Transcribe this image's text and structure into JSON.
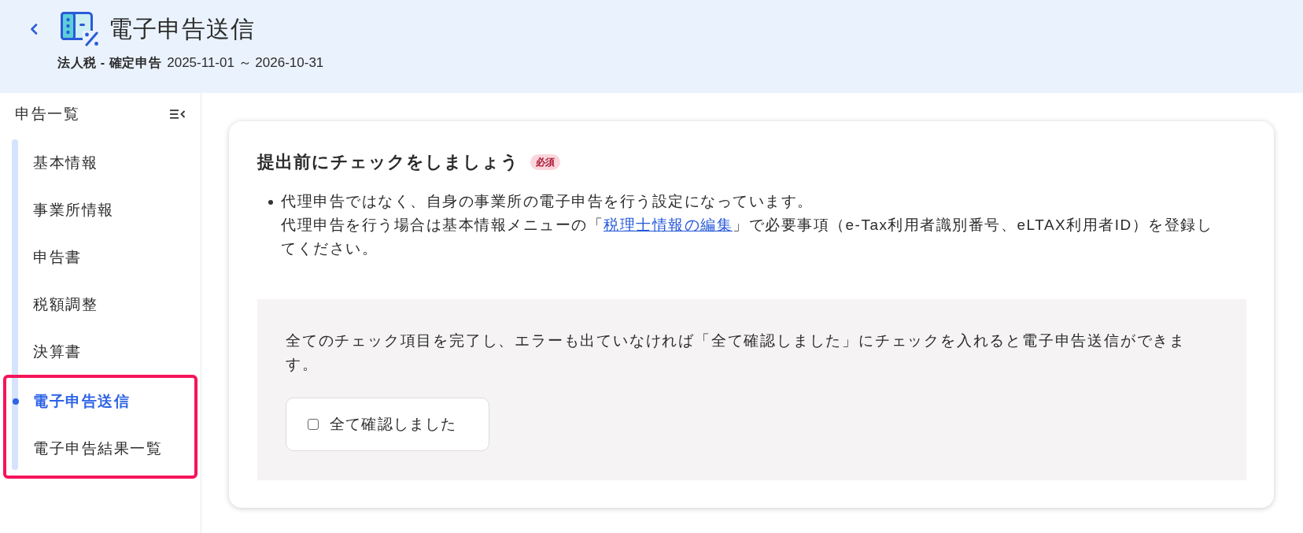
{
  "header": {
    "title": "電子申告送信",
    "filing_type": "法人税 - 確定申告",
    "period": "2025-11-01 ～ 2026-10-31"
  },
  "sidebar": {
    "title": "申告一覧",
    "groups": [
      {
        "items": [
          {
            "label": "基本情報",
            "selected": false
          },
          {
            "label": "事業所情報",
            "selected": false
          },
          {
            "label": "申告書",
            "selected": false
          },
          {
            "label": "税額調整",
            "selected": false
          },
          {
            "label": "決算書",
            "selected": false
          }
        ]
      },
      {
        "highlighted": true,
        "items": [
          {
            "label": "電子申告送信",
            "selected": true
          },
          {
            "label": "電子申告結果一覧",
            "selected": false
          }
        ]
      }
    ]
  },
  "card": {
    "title": "提出前にチェックをしましょう",
    "badge": "必須",
    "notices": [
      {
        "text": "代理申告ではなく、自身の事業所の電子申告を行う設定になっています。",
        "detail_before": "代理申告を行う場合は基本情報メニューの「",
        "link": "税理士情報の編集",
        "detail_after": "」で必要事項（e-Tax利用者識別番号、eLTAX利用者ID）を登録してください。"
      }
    ],
    "confirm": {
      "instructions": "全てのチェック項目を完了し、エラーも出ていなければ「全て確認しました」にチェックを入れると電子申告送信ができます。",
      "checkbox": {
        "label": "全て確認しました",
        "checked": false
      }
    }
  }
}
